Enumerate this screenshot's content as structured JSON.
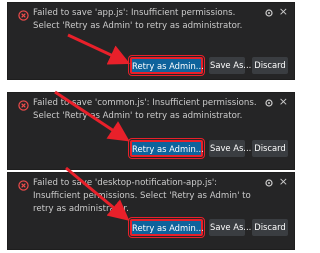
{
  "notifications": [
    {
      "message": "Failed to save 'app.js': Insufficient permissions. Select 'Retry as Admin' to retry as administrator.",
      "primary_label": "Retry as Admin...",
      "save_as_label": "Save As...",
      "discard_label": "Discard"
    },
    {
      "message": "Failed to save 'common.js': Insufficient permissions. Select 'Retry as Admin' to retry as administrator.",
      "primary_label": "Retry as Admin...",
      "save_as_label": "Save As...",
      "discard_label": "Discard"
    },
    {
      "message": "Failed to save 'desktop-notification-app.js': Insufficient permissions. Select 'Retry as Admin' to retry as administrator.",
      "primary_label": "Retry as Admin...",
      "save_as_label": "Save As...",
      "discard_label": "Discard"
    }
  ],
  "icons": {
    "error": "error-icon",
    "settings": "gear-icon",
    "close": "close-icon"
  },
  "colors": {
    "background": "#252526",
    "primary_button": "#0e639c",
    "highlight": "#e8202a",
    "arrow": "#e8202a"
  }
}
